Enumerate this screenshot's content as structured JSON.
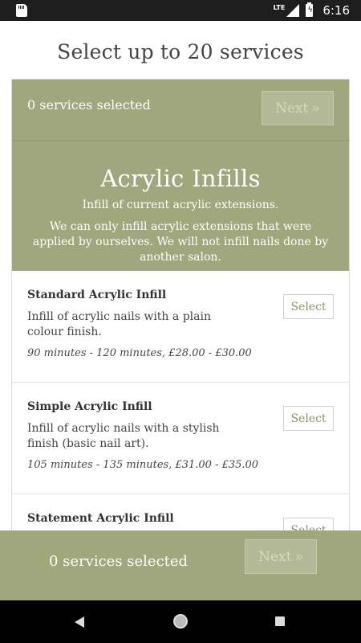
{
  "status_bar": {
    "network": "LTE",
    "time": "6:16"
  },
  "page": {
    "title": "Select up to 20 services"
  },
  "selection": {
    "count_text": "0 services selected",
    "next_label": "Next",
    "next_icon": "»"
  },
  "category": {
    "title": "Acrylic Infills",
    "description": "Infill of current acrylic extensions.",
    "note": "We can only infill acrylic extensions that were applied by ourselves. We will not infill nails done by another salon."
  },
  "services": [
    {
      "name": "Standard Acrylic Infill",
      "description": "Infill of acrylic nails with a plain colour finish.",
      "meta": "90 minutes - 120 minutes, £28.00 - £30.00",
      "select_label": "Select"
    },
    {
      "name": "Simple Acrylic Infill",
      "description": "Infill of acrylic nails with a stylish finish (basic nail art).",
      "meta": "105 minutes - 135 minutes, £31.00 - £35.00",
      "select_label": "Select"
    },
    {
      "name": "Statement Acrylic Infill",
      "description": "",
      "meta": "",
      "select_label": "Select"
    }
  ],
  "colors": {
    "accent": "#a0a77c",
    "select_text": "#8c9468"
  }
}
